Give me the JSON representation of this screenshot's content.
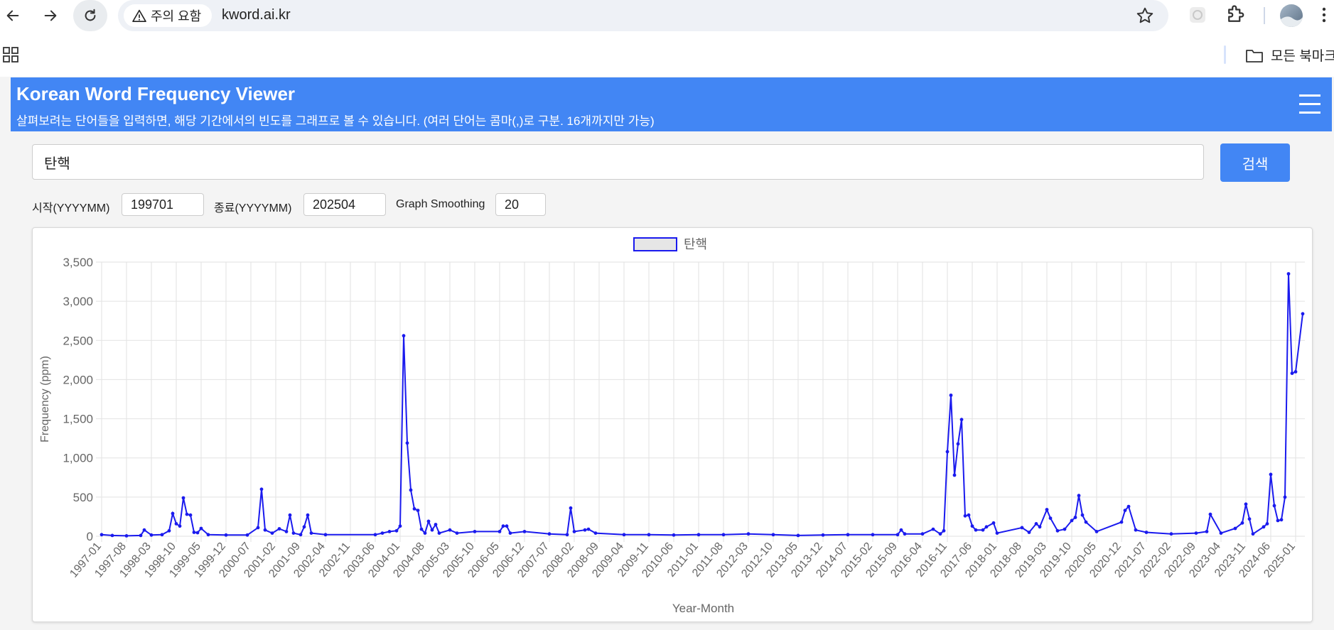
{
  "browser": {
    "security_chip_label": "주의 요함",
    "url": "kword.ai.kr",
    "bookmarks_folder_label": "모든 북마크"
  },
  "header": {
    "title": "Korean Word Frequency Viewer",
    "subtitle": "살펴보려는 단어들을 입력하면, 해당 기간에서의 빈도를 그래프로 볼 수 있습니다. (여러 단어는 콤마(,)로 구분. 16개까지만 가능)"
  },
  "search": {
    "value": "탄핵",
    "button_label": "검색"
  },
  "params": {
    "start_label": "시작(YYYYMM)",
    "start_value": "199701",
    "end_label": "종료(YYYYMM)",
    "end_value": "202504",
    "smoothing_label": "Graph Smoothing",
    "smoothing_value": "20"
  },
  "colors": {
    "accent": "#4286f4",
    "series_line": "#1a1aee",
    "legend_fill": "#e6e6e6"
  },
  "chart_data": {
    "type": "line",
    "legend_position": "top-center",
    "grid": true,
    "xlabel": "Year-Month",
    "ylabel": "Frequency (ppm)",
    "ylim": [
      0,
      3500
    ],
    "yticks": [
      "0",
      "500",
      "1,000",
      "1,500",
      "2,000",
      "2,500",
      "3,000",
      "3,500"
    ],
    "xticks": [
      "1997-01",
      "1997-08",
      "1998-03",
      "1998-10",
      "1999-05",
      "1999-12",
      "2000-07",
      "2001-02",
      "2001-09",
      "2002-04",
      "2002-11",
      "2003-06",
      "2004-01",
      "2004-08",
      "2005-03",
      "2005-10",
      "2006-05",
      "2006-12",
      "2007-07",
      "2008-02",
      "2008-09",
      "2009-04",
      "2009-11",
      "2010-06",
      "2011-01",
      "2011-08",
      "2012-03",
      "2012-10",
      "2013-05",
      "2013-12",
      "2014-07",
      "2015-02",
      "2015-09",
      "2016-04",
      "2016-11",
      "2017-06",
      "2018-01",
      "2018-08",
      "2019-03",
      "2019-10",
      "2020-05",
      "2020-12",
      "2021-07",
      "2022-02",
      "2022-09",
      "2023-04",
      "2023-11",
      "2024-06",
      "2025-01"
    ],
    "series": [
      {
        "name": "탄핵",
        "points": [
          [
            "1997-01",
            20
          ],
          [
            "1997-04",
            10
          ],
          [
            "1997-08",
            5
          ],
          [
            "1997-12",
            10
          ],
          [
            "1998-01",
            80
          ],
          [
            "1998-03",
            15
          ],
          [
            "1998-06",
            20
          ],
          [
            "1998-08",
            70
          ],
          [
            "1998-09",
            290
          ],
          [
            "1998-10",
            160
          ],
          [
            "1998-11",
            130
          ],
          [
            "1998-12",
            490
          ],
          [
            "1999-01",
            280
          ],
          [
            "1999-02",
            270
          ],
          [
            "1999-03",
            50
          ],
          [
            "1999-04",
            45
          ],
          [
            "1999-05",
            100
          ],
          [
            "1999-07",
            20
          ],
          [
            "1999-12",
            15
          ],
          [
            "2000-06",
            15
          ],
          [
            "2000-09",
            110
          ],
          [
            "2000-10",
            600
          ],
          [
            "2000-11",
            80
          ],
          [
            "2001-01",
            40
          ],
          [
            "2001-03",
            95
          ],
          [
            "2001-05",
            60
          ],
          [
            "2001-06",
            270
          ],
          [
            "2001-07",
            40
          ],
          [
            "2001-09",
            20
          ],
          [
            "2001-10",
            120
          ],
          [
            "2001-11",
            270
          ],
          [
            "2001-12",
            40
          ],
          [
            "2002-04",
            20
          ],
          [
            "2003-06",
            20
          ],
          [
            "2003-08",
            40
          ],
          [
            "2003-10",
            60
          ],
          [
            "2003-12",
            70
          ],
          [
            "2004-01",
            130
          ],
          [
            "2004-02",
            2560
          ],
          [
            "2004-03",
            1190
          ],
          [
            "2004-04",
            590
          ],
          [
            "2004-05",
            350
          ],
          [
            "2004-06",
            330
          ],
          [
            "2004-07",
            90
          ],
          [
            "2004-08",
            40
          ],
          [
            "2004-09",
            190
          ],
          [
            "2004-10",
            80
          ],
          [
            "2004-11",
            150
          ],
          [
            "2004-12",
            40
          ],
          [
            "2005-03",
            80
          ],
          [
            "2005-05",
            40
          ],
          [
            "2005-10",
            60
          ],
          [
            "2006-05",
            60
          ],
          [
            "2006-06",
            130
          ],
          [
            "2006-07",
            130
          ],
          [
            "2006-08",
            40
          ],
          [
            "2006-12",
            60
          ],
          [
            "2007-07",
            30
          ],
          [
            "2007-12",
            20
          ],
          [
            "2008-01",
            360
          ],
          [
            "2008-02",
            60
          ],
          [
            "2008-05",
            80
          ],
          [
            "2008-06",
            90
          ],
          [
            "2008-08",
            40
          ],
          [
            "2009-04",
            20
          ],
          [
            "2009-11",
            20
          ],
          [
            "2010-06",
            15
          ],
          [
            "2011-01",
            20
          ],
          [
            "2011-08",
            20
          ],
          [
            "2012-03",
            30
          ],
          [
            "2012-10",
            20
          ],
          [
            "2013-05",
            10
          ],
          [
            "2013-12",
            15
          ],
          [
            "2014-07",
            20
          ],
          [
            "2015-02",
            20
          ],
          [
            "2015-09",
            20
          ],
          [
            "2015-10",
            80
          ],
          [
            "2015-11",
            30
          ],
          [
            "2016-04",
            30
          ],
          [
            "2016-07",
            90
          ],
          [
            "2016-09",
            30
          ],
          [
            "2016-10",
            70
          ],
          [
            "2016-11",
            1080
          ],
          [
            "2016-12",
            1800
          ],
          [
            "2017-01",
            780
          ],
          [
            "2017-02",
            1180
          ],
          [
            "2017-03",
            1490
          ],
          [
            "2017-04",
            260
          ],
          [
            "2017-05",
            270
          ],
          [
            "2017-06",
            130
          ],
          [
            "2017-07",
            80
          ],
          [
            "2017-09",
            80
          ],
          [
            "2017-10",
            120
          ],
          [
            "2017-12",
            170
          ],
          [
            "2018-01",
            40
          ],
          [
            "2018-08",
            110
          ],
          [
            "2018-10",
            50
          ],
          [
            "2018-12",
            160
          ],
          [
            "2019-01",
            120
          ],
          [
            "2019-03",
            340
          ],
          [
            "2019-04",
            230
          ],
          [
            "2019-06",
            70
          ],
          [
            "2019-08",
            90
          ],
          [
            "2019-10",
            200
          ],
          [
            "2019-11",
            240
          ],
          [
            "2019-12",
            520
          ],
          [
            "2020-01",
            270
          ],
          [
            "2020-02",
            180
          ],
          [
            "2020-05",
            60
          ],
          [
            "2020-12",
            180
          ],
          [
            "2021-01",
            330
          ],
          [
            "2021-02",
            380
          ],
          [
            "2021-04",
            80
          ],
          [
            "2021-07",
            50
          ],
          [
            "2022-02",
            30
          ],
          [
            "2022-09",
            40
          ],
          [
            "2022-12",
            60
          ],
          [
            "2023-01",
            280
          ],
          [
            "2023-04",
            40
          ],
          [
            "2023-08",
            100
          ],
          [
            "2023-10",
            170
          ],
          [
            "2023-11",
            410
          ],
          [
            "2023-12",
            220
          ],
          [
            "2024-01",
            30
          ],
          [
            "2024-04",
            120
          ],
          [
            "2024-05",
            160
          ],
          [
            "2024-06",
            790
          ],
          [
            "2024-07",
            390
          ],
          [
            "2024-08",
            200
          ],
          [
            "2024-09",
            210
          ],
          [
            "2024-10",
            500
          ],
          [
            "2024-11",
            3350
          ],
          [
            "2024-12",
            2080
          ],
          [
            "2025-01",
            2100
          ],
          [
            "2025-03",
            2840
          ]
        ]
      }
    ]
  }
}
